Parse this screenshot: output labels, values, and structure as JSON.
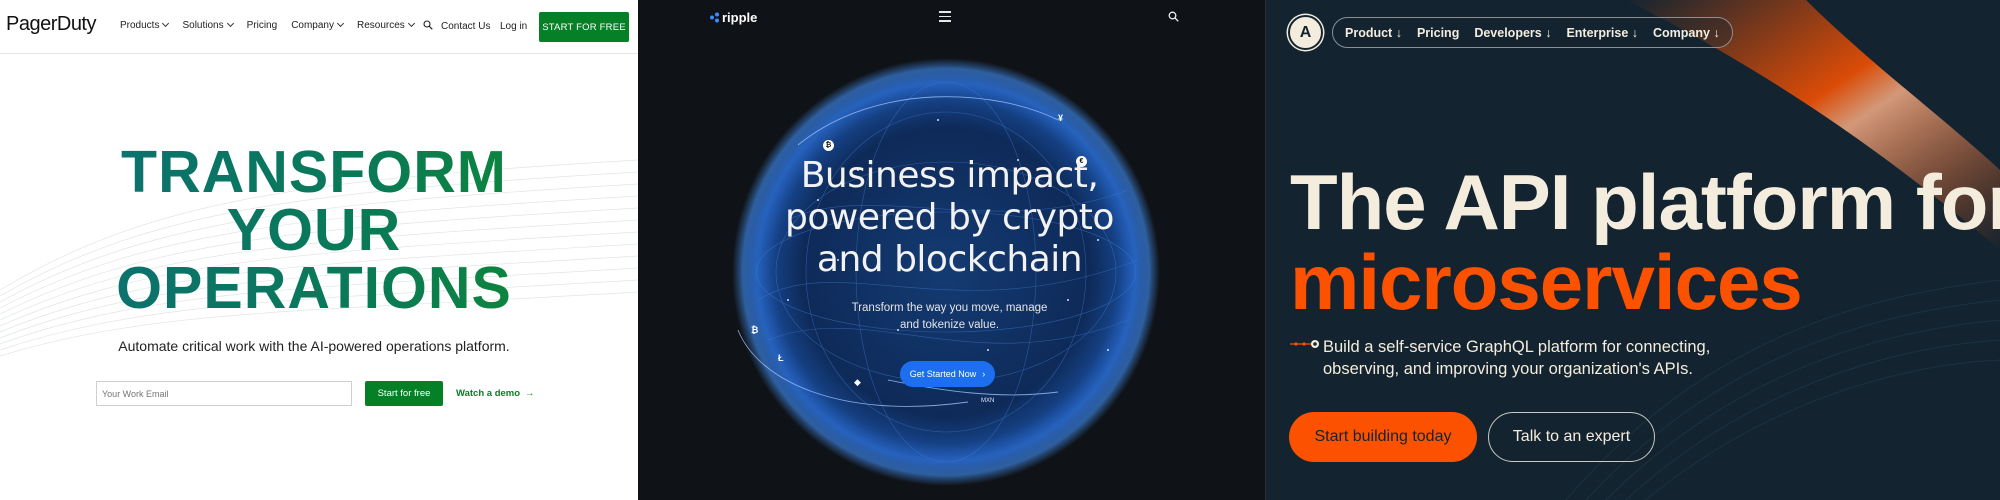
{
  "pagerduty": {
    "logo": "PagerDuty",
    "nav": {
      "items": [
        "Products",
        "Solutions",
        "Pricing",
        "Company",
        "Resources"
      ],
      "contact": "Contact Us",
      "login": "Log in",
      "cta": "START FOR FREE"
    },
    "headline": [
      "TRANSFORM",
      "YOUR",
      "OPERATIONS"
    ],
    "subheadline": "Automate critical work with the AI-powered operations platform.",
    "email_placeholder": "Your Work Email",
    "start_button": "Start for free",
    "demo_link": "Watch a demo",
    "colors": {
      "brand_green": "#068026",
      "headline_teal": "#0c6e79"
    }
  },
  "ripple": {
    "logo": "ripple",
    "headline": [
      "Business impact,",
      "powered by crypto",
      "and blockchain"
    ],
    "subheadline": [
      "Transform the way you move, manage",
      "and tokenize value."
    ],
    "cta": "Get Started Now",
    "currency_labels": [
      "₿",
      "¥",
      "€",
      "₿",
      "Ł",
      "◆",
      "MXN"
    ],
    "colors": {
      "background": "#0f1216",
      "accent_blue": "#1e6ff0"
    }
  },
  "apollo": {
    "logo_letter": "A",
    "nav": [
      "Product ↓",
      "Pricing",
      "Developers ↓",
      "Enterprise ↓",
      "Company ↓"
    ],
    "headline_line1": "The API platform for",
    "headline_line2": "microservices",
    "subheadline": "Build a self-service GraphQL platform for connecting, observing, and improving your organization's APIs.",
    "primary_button": "Start building today",
    "secondary_button": "Talk to an expert",
    "colors": {
      "background": "#132430",
      "accent_orange": "#fc5200",
      "text_cream": "#f4ecdd"
    }
  }
}
